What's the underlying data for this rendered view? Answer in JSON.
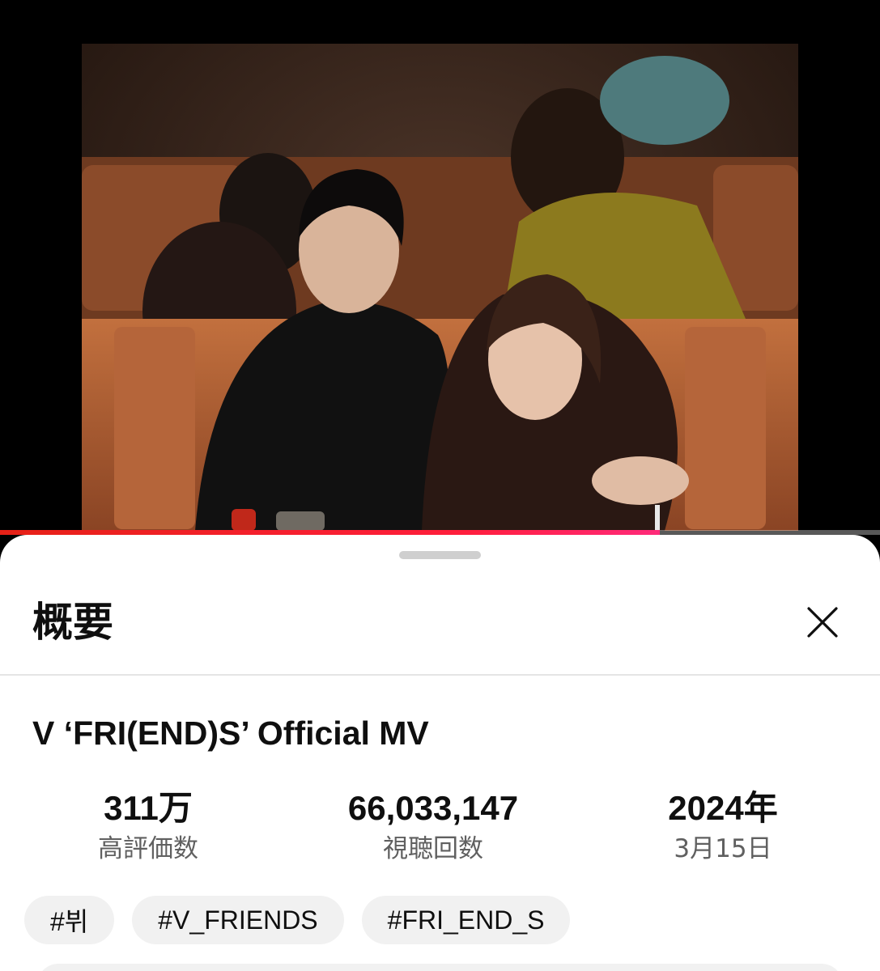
{
  "video": {
    "progress": 0.75,
    "colors": {
      "progress": "#ff1e3c",
      "track": "#8a8a8a"
    }
  },
  "sheet": {
    "title": "概要",
    "close_icon": "close-icon"
  },
  "details": {
    "title": "V ‘FRI(END)S’ Official MV",
    "stats": [
      {
        "value": "311万",
        "label": "高評価数"
      },
      {
        "value": "66,033,147",
        "label": "視聴回数"
      },
      {
        "value": "2024年",
        "label": "3月15日"
      }
    ],
    "hashtags": [
      "#뷔",
      "#V_FRIENDS",
      "#FRI_END_S"
    ]
  }
}
